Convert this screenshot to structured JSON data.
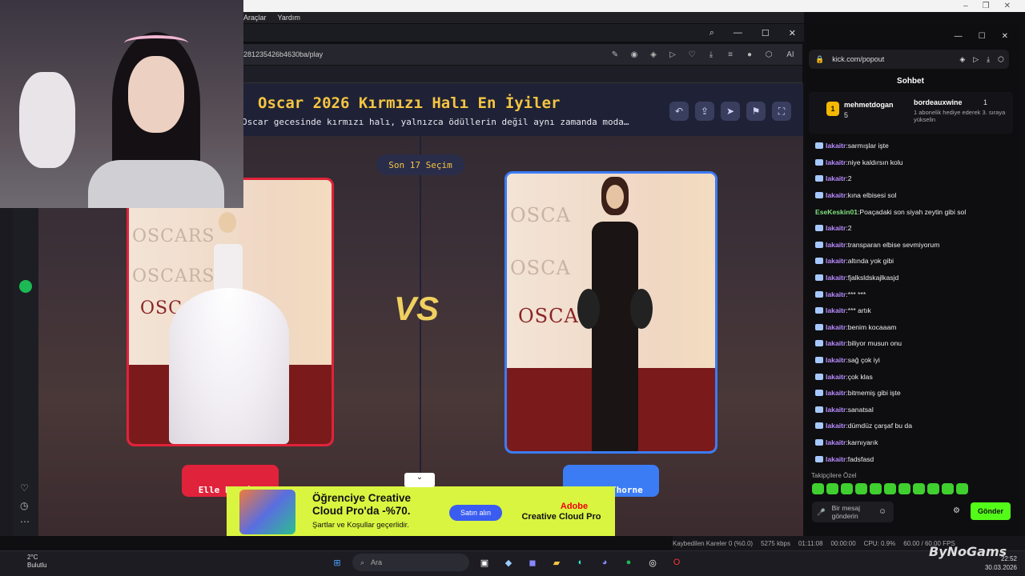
{
  "browser": {
    "menu_items": [
      "Araçlar",
      "Yardım"
    ],
    "address_partial": "281235426b4630ba/play",
    "ai_label": "AI"
  },
  "game": {
    "title": "Oscar 2026 Kırmızı Halı En İyiler",
    "subtitle": "Oscar gecesinde kırmızı halı, yalnızca ödüllerin değil aynı zamanda moda…",
    "round_label": "Son 17 Seçim",
    "vs_label": "VS",
    "left_name": "Elle Fanning",
    "right_name": "Bella Thorne",
    "oscar_wall_text": "OSCARS",
    "oscar_wall_text_right": "OSCA"
  },
  "ad": {
    "headline": "Öğrenciye Creative Cloud Pro'da -%70.",
    "terms": "Şartlar ve Koşullar geçerlidir.",
    "cta": "Satın alın",
    "brand_line1": "Adobe",
    "brand_line2": "Creative Cloud Pro"
  },
  "chat": {
    "url": "kick.com/popout",
    "header": "Sohbet",
    "leaderboard": [
      {
        "rank": "1",
        "name": "mehmetdogan",
        "count": "5"
      },
      {
        "name": "bordeauxwine",
        "count": "1",
        "note": "1 abonelik hediye ederek 3. sıraya yükselin"
      }
    ],
    "messages": [
      {
        "user": "lakaitr",
        "text": "sarmışlar işte"
      },
      {
        "user": "lakaitr",
        "text": "niye kaldırsın kolu"
      },
      {
        "user": "lakaitr",
        "text": "2"
      },
      {
        "user": "lakaitr",
        "text": "kına elbisesi sol"
      },
      {
        "user": "EseKeskin01",
        "text": "Poaçadaki son siyah zeytin gibi sol",
        "green": true
      },
      {
        "user": "lakaitr",
        "text": "2"
      },
      {
        "user": "lakaitr",
        "text": "transparan elbise sevmiyorum"
      },
      {
        "user": "lakaitr",
        "text": "altında yok gibi"
      },
      {
        "user": "lakaitr",
        "text": "fjalksldskajlkasjd"
      },
      {
        "user": "lakaitr",
        "text": "*** ***"
      },
      {
        "user": "lakaitr",
        "text": "*** artık"
      },
      {
        "user": "lakaitr",
        "text": "benim kocaaam"
      },
      {
        "user": "lakaitr",
        "text": "biliyor musun onu"
      },
      {
        "user": "lakaitr",
        "text": "sağ çok iyi"
      },
      {
        "user": "lakaitr",
        "text": "çok klas"
      },
      {
        "user": "lakaitr",
        "text": "bitmemiş gibi işte"
      },
      {
        "user": "lakaitr",
        "text": "sanatsal"
      },
      {
        "user": "lakaitr",
        "text": "dümdüz çarşaf bu da"
      },
      {
        "user": "lakaitr",
        "text": "karnıyarık"
      },
      {
        "user": "lakaitr",
        "text": "fadsfasd"
      }
    ],
    "followers_label": "Takipçilere Özel",
    "input_placeholder": "Bir mesaj gönderin",
    "send_label": "Gönder"
  },
  "status": {
    "dropped": "Kaybedilen Kareler 0 (%0.0)",
    "bitrate": "5275 kbps",
    "stream_time": "01:11:08",
    "rec_time": "00:00:00",
    "cpu": "CPU: 0.9%",
    "fps": "60.00 / 60.00 FPS"
  },
  "taskbar": {
    "temp": "2°C",
    "weather": "Bulutlu",
    "search": "Ara",
    "time": "22:52",
    "date": "30.03.2026"
  },
  "watermark": "ByNoGams",
  "colors": {
    "accent_red": "#e0223a",
    "accent_blue": "#3b7cf5",
    "gold": "#f5c542",
    "kick_green": "#53fc18"
  }
}
